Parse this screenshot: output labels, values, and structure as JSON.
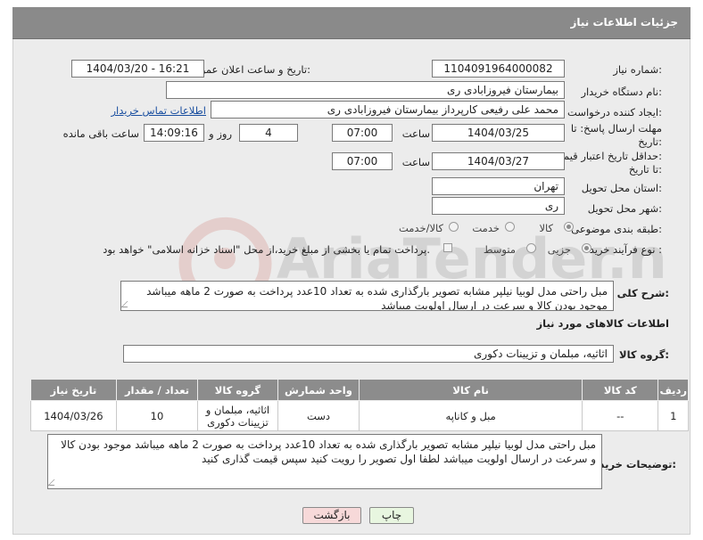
{
  "header": {
    "title": "جزئیات اطلاعات نیاز"
  },
  "fields": {
    "need_number": {
      "label": "شماره نیاز:",
      "value": "1104091964000082"
    },
    "announce": {
      "label": "تاریخ و ساعت اعلان عمومی:",
      "value": "1404/03/20 - 16:21"
    },
    "buyer_org": {
      "label": "نام دستگاه خریدار:",
      "value": "بیمارستان فیروزابادی ری"
    },
    "creator": {
      "label": "ایجاد کننده درخواست:",
      "value": "محمد علی رفیعی کارپرداز بیمارستان فیروزابادی ری",
      "contact_link": "اطلاعات تماس خریدار"
    },
    "deadline": {
      "label_line1": "مهلت ارسال پاسخ: تا",
      "label_line2": "تاریخ:",
      "date": "1404/03/25",
      "time_label": "ساعت",
      "time": "07:00",
      "days": "4",
      "days_label": "روز و",
      "remaining": "14:09:16",
      "remaining_label": "ساعت باقی مانده"
    },
    "validity": {
      "label_line1": "حداقل تاریخ اعتبار قیمت:",
      "label_line2": "تا تاریخ:",
      "date": "1404/03/27",
      "time_label": "ساعت",
      "time": "07:00"
    },
    "province": {
      "label": "استان محل تحویل:",
      "value": "تهران"
    },
    "city": {
      "label": "شهر محل تحویل:",
      "value": "ری"
    },
    "category": {
      "label": "طبقه بندی موضوعی:",
      "options": [
        "کالا",
        "خدمت",
        "کالا/خدمت"
      ],
      "selected": "کالا"
    },
    "purchase_type": {
      "label": "نوع فرآیند خرید :",
      "options": [
        "جزیی",
        "متوسط"
      ],
      "selected": "جزیی",
      "checkbox_text": "پرداخت تمام یا بخشی از مبلغ خرید،از محل \"اسناد خزانه اسلامی\" خواهد بود."
    }
  },
  "description": {
    "label": "شرح کلی نیاز:",
    "text": "مبل راحتی مدل لوبیا نیلپر مشابه تصویر بارگذاری شده به تعداد 10عدد پرداخت به صورت 2 ماهه میباشد موجود بودن کالا و سرعت در ارسال اولویت میباشد"
  },
  "goods_info": {
    "title": "اطلاعات کالاهای مورد نیاز",
    "group_label": "گروه کالا:",
    "group_value": "اثاثیه، مبلمان و تزیینات دکوری"
  },
  "table": {
    "headers": [
      "ردیف",
      "کد کالا",
      "نام کالا",
      "واحد شمارش",
      "گروه کالا",
      "تعداد / مقدار",
      "تاریخ نیاز"
    ],
    "rows": [
      {
        "row": "1",
        "code": "--",
        "name": "مبل و کاناپه",
        "unit": "دست",
        "group": "اثاثیه، مبلمان و تزیینات دکوری",
        "qty": "10",
        "date": "1404/03/26"
      }
    ]
  },
  "buyer_notes": {
    "label": "توضیحات خریدار:",
    "text": "مبل راحتی مدل لوبیا نیلپر مشابه تصویر بارگذاری شده به تعداد 10عدد پرداخت به صورت 2 ماهه میباشد موجود بودن کالا و سرعت در ارسال اولویت میباشد لطفا اول تصویر را رویت کنید سپس قیمت گذاری کنید"
  },
  "buttons": {
    "print": "چاپ",
    "back": "بازگشت"
  },
  "colors": {
    "header_bg": "#8a8a8a",
    "back_button_bg": "#f7d9d9",
    "print_button_bg": "#e8f6e0",
    "link": "#1a4fa0"
  }
}
